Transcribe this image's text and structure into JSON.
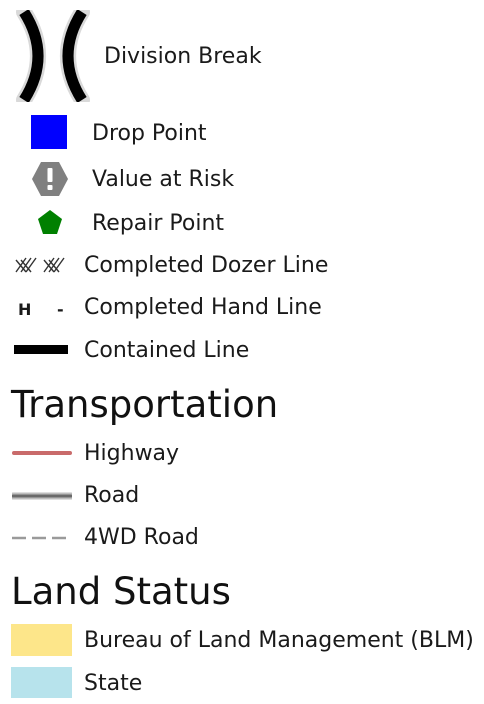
{
  "legend": {
    "items": [
      {
        "label": "Division Break",
        "symbol": "division-break-icon",
        "color": "#000000"
      },
      {
        "label": "Drop Point",
        "symbol": "blue-square-icon",
        "color": "#0000ff"
      },
      {
        "label": "Value at Risk",
        "symbol": "exclamation-octagon-icon",
        "color": "#808080"
      },
      {
        "label": "Repair Point",
        "symbol": "green-pentagon-icon",
        "color": "#008000"
      },
      {
        "label": "Completed Dozer Line",
        "symbol": "dozer-line-icon",
        "color": "#333333"
      },
      {
        "label": "Completed Hand Line",
        "symbol": "hand-line-icon",
        "color": "#000000",
        "symbol_text": "H -"
      },
      {
        "label": "Contained Line",
        "symbol": "thick-line-icon",
        "color": "#000000"
      }
    ],
    "sections": [
      {
        "title": "Transportation",
        "items": [
          {
            "label": "Highway",
            "symbol": "highway-line-icon",
            "color": "#c96b6b"
          },
          {
            "label": "Road",
            "symbol": "road-line-icon",
            "color": "#707070"
          },
          {
            "label": "4WD Road",
            "symbol": "dashed-road-icon",
            "color": "#9a9a9a"
          }
        ]
      },
      {
        "title": "Land Status",
        "items": [
          {
            "label": "Bureau of Land Management (BLM)",
            "symbol": "blm-swatch-icon",
            "color": "#fde68a"
          },
          {
            "label": "State",
            "symbol": "state-swatch-icon",
            "color": "#b7e3ec"
          }
        ]
      }
    ]
  }
}
